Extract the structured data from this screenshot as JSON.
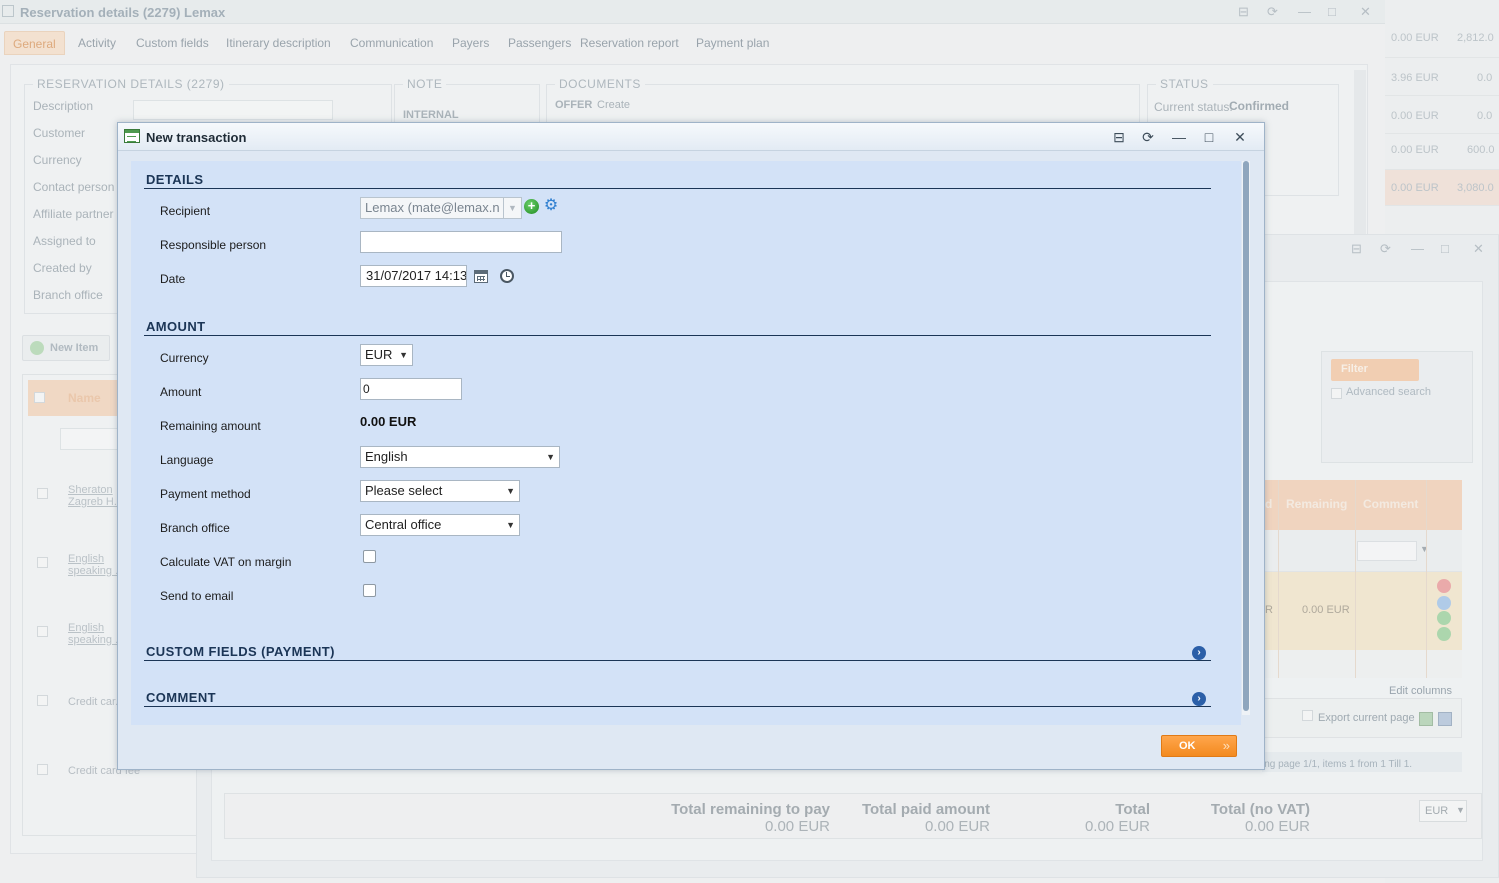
{
  "background": {
    "window_title": "Reservation details (2279) Lemax",
    "tabs": [
      "General",
      "Activity",
      "Custom fields",
      "Itinerary description",
      "Communication",
      "Payers",
      "Passengers",
      "Reservation report",
      "Payment plan"
    ],
    "reservation_legend": "RESERVATION DETAILS (2279)",
    "note_legend": "NOTE",
    "note_internal": "INTERNAL",
    "documents_legend": "DOCUMENTS",
    "documents_offer": "OFFER",
    "documents_create": "Create",
    "status_legend": "STATUS",
    "current_status_label": "Current status:",
    "current_status_value": "Confirmed",
    "field_labels": [
      "Description",
      "Customer",
      "Currency",
      "Contact person",
      "Affiliate partner",
      "Assigned to",
      "Created by",
      "Branch office"
    ],
    "new_item_label": "New Item",
    "name_header": "Name",
    "items": [
      "Sheraton Zagreb H...",
      "English speaking ...",
      "English speaking ...",
      "Credit car...",
      "Credit card fee"
    ],
    "right_strip_values": [
      "0.00 EUR",
      "3.96 EUR",
      "0.00 EUR",
      "0.00 EUR",
      "0.00 EUR"
    ],
    "right_strip_values2": [
      "2,812.0",
      "0.0",
      "0.0",
      "600.0",
      "3,080.0"
    ],
    "filter_label": "Filter",
    "advanced_search": "Advanced search",
    "grid_headers": [
      "d",
      "Remaining",
      "Comment"
    ],
    "grid_remaining_value": "0.00 EUR",
    "grid_r_fragment": "R",
    "edit_columns": "Edit columns",
    "export_current_page": "Export current page",
    "paging_text": "ing page  1/1,  items  1  from  1  Till  1.",
    "totals": {
      "remaining_label": "Total remaining to pay",
      "remaining_value": "0.00 EUR",
      "paid_label": "Total paid amount",
      "paid_value": "0.00 EUR",
      "total_label": "Total",
      "total_value": "0.00 EUR",
      "novat_label": "Total (no VAT)",
      "novat_value": "0.00 EUR",
      "currency": "EUR"
    }
  },
  "modal": {
    "title": "New transaction",
    "details_title": "DETAILS",
    "recipient_label": "Recipient",
    "recipient_value": "Lemax (mate@lemax.n",
    "responsible_label": "Responsible person",
    "responsible_value": "",
    "date_label": "Date",
    "date_value": "31/07/2017 14:13",
    "amount_title": "AMOUNT",
    "currency_label": "Currency",
    "currency_value": "EUR",
    "amount_label": "Amount",
    "amount_value": "0",
    "remaining_label": "Remaining amount",
    "remaining_value": "0.00 EUR",
    "language_label": "Language",
    "language_value": "English",
    "payment_method_label": "Payment method",
    "payment_method_value": "Please select",
    "branch_office_label": "Branch office",
    "branch_office_value": "Central office",
    "vat_margin_label": "Calculate VAT on margin",
    "send_email_label": "Send to email",
    "custom_fields_title": "CUSTOM FIELDS (PAYMENT)",
    "comment_title": "COMMENT",
    "ok_label": "OK"
  }
}
